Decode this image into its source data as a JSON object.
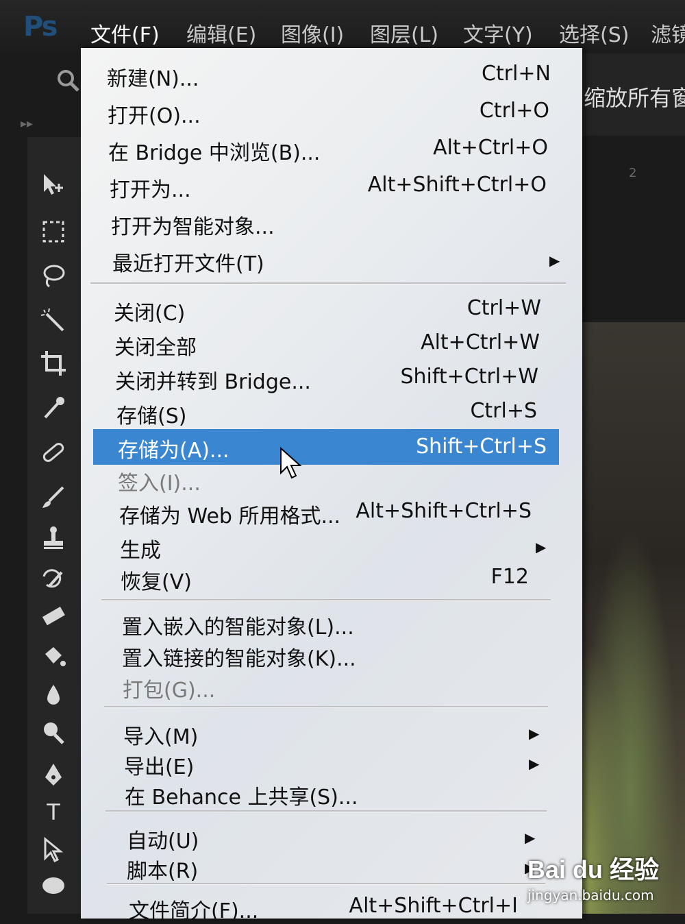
{
  "app": {
    "logo": "Ps",
    "menubar": [
      {
        "label": "文件(F)",
        "active": true
      },
      {
        "label": "编辑(E)",
        "active": false
      },
      {
        "label": "图像(I)",
        "active": false
      },
      {
        "label": "图层(L)",
        "active": false
      },
      {
        "label": "文字(Y)",
        "active": false
      },
      {
        "label": "选择(S)",
        "active": false
      },
      {
        "label": "滤镜",
        "active": false
      }
    ],
    "options_bar_right_label": "缩放所有窗口",
    "tab_number": "2"
  },
  "file_menu": {
    "items": [
      {
        "label": "新建(N)...",
        "shortcut": "Ctrl+N"
      },
      {
        "label": "打开(O)...",
        "shortcut": "Ctrl+O"
      },
      {
        "label": "在 Bridge 中浏览(B)...",
        "shortcut": "Alt+Ctrl+O"
      },
      {
        "label": "打开为...",
        "shortcut": "Alt+Shift+Ctrl+O"
      },
      {
        "label": "打开为智能对象...",
        "shortcut": ""
      },
      {
        "label": "最近打开文件(T)",
        "shortcut": "",
        "submenu": true
      },
      {
        "label": "关闭(C)",
        "shortcut": "Ctrl+W"
      },
      {
        "label": "关闭全部",
        "shortcut": "Alt+Ctrl+W"
      },
      {
        "label": "关闭并转到 Bridge...",
        "shortcut": "Shift+Ctrl+W"
      },
      {
        "label": "存储(S)",
        "shortcut": "Ctrl+S"
      },
      {
        "label": "存储为(A)...",
        "shortcut": "Shift+Ctrl+S",
        "highlighted": true
      },
      {
        "label": "签入(I)...",
        "shortcut": "",
        "disabled": true
      },
      {
        "label": "存储为 Web 所用格式...",
        "shortcut": "Alt+Shift+Ctrl+S"
      },
      {
        "label": "生成",
        "shortcut": "",
        "submenu": true
      },
      {
        "label": "恢复(V)",
        "shortcut": "F12"
      },
      {
        "label": "置入嵌入的智能对象(L)...",
        "shortcut": ""
      },
      {
        "label": "置入链接的智能对象(K)...",
        "shortcut": ""
      },
      {
        "label": "打包(G)...",
        "shortcut": "",
        "disabled": true
      },
      {
        "label": "导入(M)",
        "shortcut": "",
        "submenu": true
      },
      {
        "label": "导出(E)",
        "shortcut": "",
        "submenu": true
      },
      {
        "label": "在 Behance 上共享(S)...",
        "shortcut": ""
      },
      {
        "label": "自动(U)",
        "shortcut": "",
        "submenu": true
      },
      {
        "label": "脚本(R)",
        "shortcut": "",
        "submenu": true
      },
      {
        "label": "文件简介(F)...",
        "shortcut": "Alt+Shift+Ctrl+I"
      }
    ],
    "submenu_arrow": "▶"
  },
  "toolbar": {
    "tools": [
      "move-tool",
      "marquee-tool",
      "lasso-tool",
      "magic-wand-tool",
      "crop-tool",
      "eyedropper-tool",
      "healing-brush-tool",
      "brush-tool",
      "clone-stamp-tool",
      "history-brush-tool",
      "eraser-tool",
      "paint-bucket-tool",
      "blur-tool",
      "dodge-tool",
      "pen-tool",
      "type-tool",
      "path-selection-tool",
      "shape-tool"
    ],
    "type_tool_glyph": "T"
  },
  "watermark": {
    "brand": "Bai du 经验",
    "url": "jingyan.baidu.com"
  },
  "colors": {
    "menu_highlight": "#3a86d0",
    "menu_bg": "#e9ecef",
    "app_bg": "#1b1b1b"
  }
}
